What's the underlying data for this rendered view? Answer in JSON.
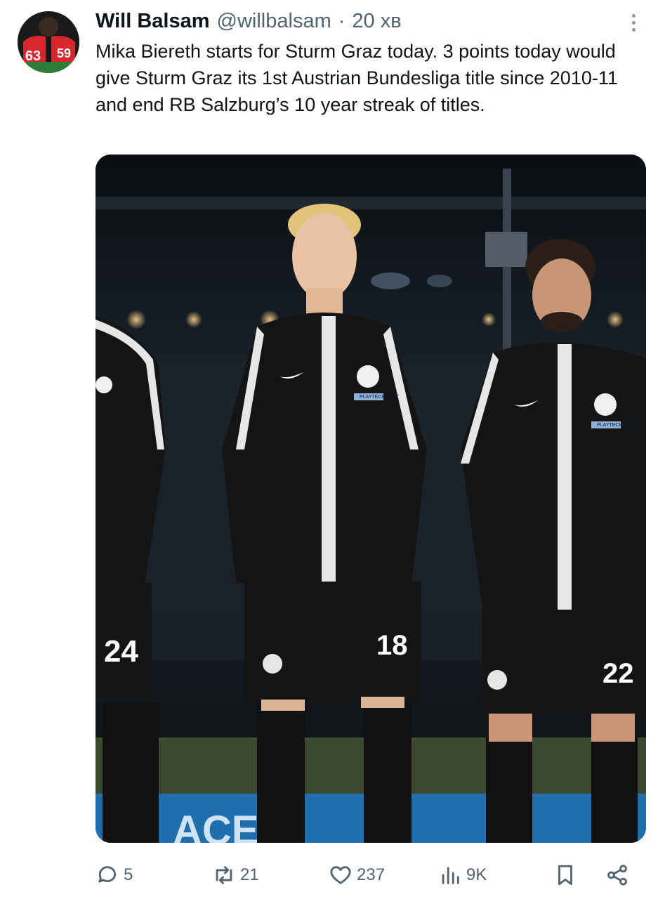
{
  "tweet": {
    "author_name": "Will Balsam",
    "author_handle": "@willbalsam",
    "separator": "·",
    "time_ago": "20 хв",
    "text": "Mika Biereth starts for Sturm Graz today. 3 points today would give Sturm Graz its 1st Austrian Bundesliga title since 2010-11 and end RB Salzburg’s 10 year streak of titles.",
    "avatar": {
      "jersey_numbers": [
        "63",
        "59"
      ],
      "jersey_color": "#d7262c"
    },
    "media": {
      "jersey_numbers": [
        "24",
        "18",
        "22"
      ],
      "sponsor_text": "PLAYTECHMEET",
      "banner_text": "ACE"
    },
    "actions": {
      "reply_count": "5",
      "retweet_count": "21",
      "like_count": "237",
      "views_count": "9K"
    }
  },
  "icons": {
    "reply": "reply-bubble-icon",
    "retweet": "retweet-icon",
    "like": "heart-icon",
    "views": "bar-chart-icon",
    "bookmark": "bookmark-icon",
    "share": "share-icon",
    "more": "more-vertical-icon"
  },
  "colors": {
    "text_primary": "#0f1419",
    "text_secondary": "#536471",
    "kit_black": "#121212",
    "kit_white": "#e8e8e8"
  }
}
